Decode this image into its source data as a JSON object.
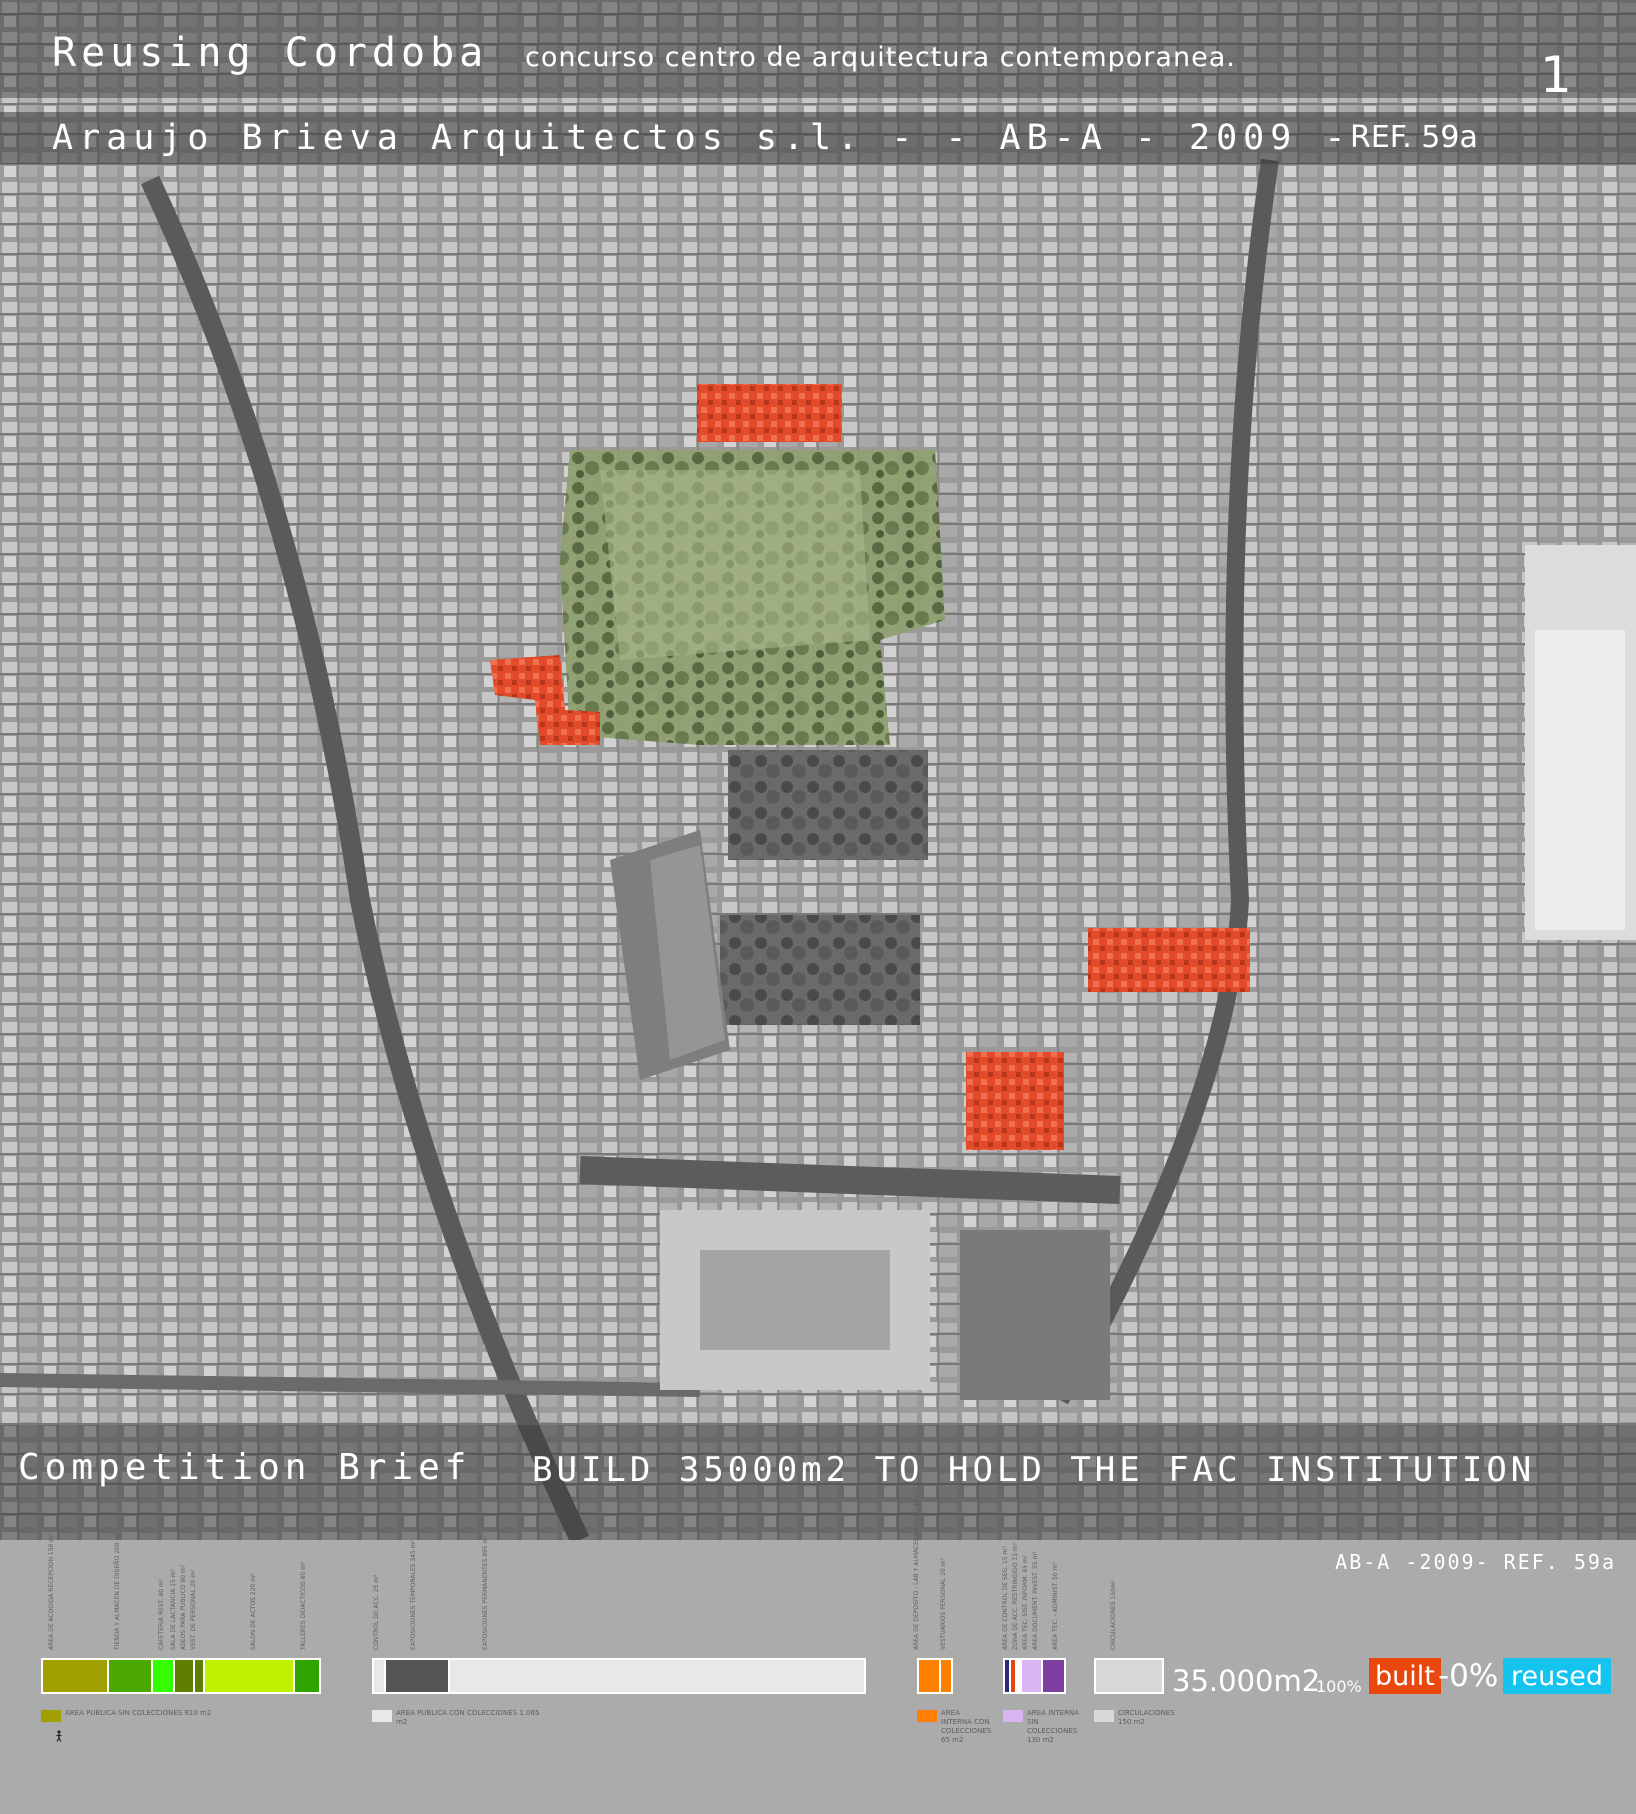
{
  "header": {
    "title": "Reusing Cordoba",
    "subtitle": "concurso centro de arquitectura contemporanea.",
    "sheet_number": "1",
    "authors": "Araujo Brieva Arquitectos s.l. -  -  AB-A - 2009 -",
    "ref": "REF. 59a"
  },
  "brief": {
    "label": "Competition Brief",
    "text": "BUILD 35000m2 TO HOLD THE FAC INSTITUTION"
  },
  "footer": {
    "ref": "AB-A -2009- REF. 59a",
    "total": "35.000m2",
    "percent": "100%",
    "built": "built",
    "zero": "-0%",
    "reused": "reused"
  },
  "program_groups": [
    {
      "labels": [
        "AREA DE ACOGIDA RECEPCION 150 m²",
        "TIENDA Y ALMACÉN DE DISEÑO 200 m²",
        "CAFETERIA REST. 80 m²",
        "SALA DE LACTANCIA 15 m²",
        "ASEOS PARA PUBLICO 80 m²",
        "VEST. DE PERSONAL 20 m²",
        "SALON DE ACTOS 220 m²",
        "TALLERES DIDACTICOS 80 m²"
      ],
      "legend": "AREA PUBLICA SIN COLECCIONES 810 m2",
      "legend_color": "#a0a000"
    },
    {
      "labels": [
        "CONTROL DE ACC. 25 m²",
        "EXPOSICIONES TEMPORALES 345 m²",
        "EXPOSICIONES PERMANENTES 895 m²"
      ],
      "legend": "AREA PUBLICA CON COLECCIONES 1.065 m2",
      "legend_color": "#e8e8e8"
    },
    {
      "labels": [
        "AREA DE DEPOSITO - LAB Y ALMACENAMIENTO 45 m²",
        "VESTUARIOS PERSONAL 20 m²"
      ],
      "legend": "AREA INTERNA CON COLECCIONES 65 m2",
      "legend_color": "#ff7f00"
    },
    {
      "labels": [
        "AREA DE CONTROL DE SEG. 15 m²",
        "ZONA DE ACC. RESTRINGIDO 15 m²",
        "AREA TEC. SIST. INFORM. 45 m²",
        "AREA DOCUMENT. INVEST. 55 m²",
        "AREA TEC. - ADMINIST. 50 m²"
      ],
      "legend": "AREA INTERNA SIN COLECCIONES 130 m2",
      "legend_color": "#d8b4f0"
    },
    {
      "labels": [
        "CIRCULACIONES 150m²"
      ],
      "legend": "CIRCULACIONES 150 m2",
      "legend_color": "#d8d8d8"
    }
  ],
  "colors": {
    "olive": "#a0a000",
    "green": "#4aa800",
    "bright_green": "#33ff00",
    "dark_green": "#5f7f00",
    "lime": "#bff200",
    "mid_green": "#2fa600",
    "grey_dark": "#555555",
    "grey_light": "#e8e8e8",
    "orange": "#ff7f00",
    "navy": "#2a2a7a",
    "red": "#e8480f",
    "lilac": "#d8b4f0",
    "purple": "#7d3fa0",
    "circ": "#d8d8d8",
    "built": "#e8480f",
    "reused": "#14c3ee"
  },
  "icons": [
    "person-icon"
  ]
}
